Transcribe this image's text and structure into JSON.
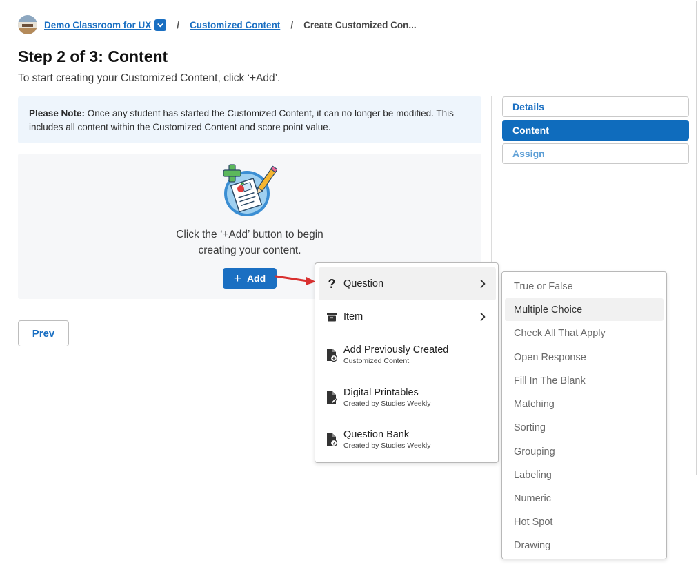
{
  "breadcrumb": {
    "classroom": "Demo Classroom for UX",
    "section": "Customized Content",
    "current": "Create Customized Con..."
  },
  "page": {
    "title": "Step 2 of 3: Content",
    "subtitle": "To start creating your Customized Content, click ‘+Add’."
  },
  "note": {
    "label": "Please Note:",
    "text": " Once any student has started the Customized Content, it can no longer be modified.  This includes all content within the Customized Content and score point value."
  },
  "empty_state": {
    "line1": "Click the ‘+Add’ button to begin",
    "line2": "creating your content.",
    "add_label": "Add"
  },
  "steps": [
    {
      "label": "Details",
      "state": "done"
    },
    {
      "label": "Content",
      "state": "active"
    },
    {
      "label": "Assign",
      "state": "todo"
    }
  ],
  "prev_label": "Prev",
  "add_menu": {
    "items": [
      {
        "label": "Question",
        "icon": "question-mark-icon",
        "has_submenu": true,
        "highlighted": true
      },
      {
        "label": "Item",
        "icon": "box-icon",
        "has_submenu": true
      },
      {
        "label": "Add Previously Created",
        "sublabel": "Customized Content",
        "icon": "file-plus-icon"
      },
      {
        "label": "Digital Printables",
        "sublabel": "Created by Studies Weekly",
        "icon": "file-edit-icon"
      },
      {
        "label": "Question Bank",
        "sublabel": "Created by Studies Weekly",
        "icon": "file-question-icon"
      }
    ]
  },
  "question_submenu": {
    "items": [
      "True or False",
      "Multiple Choice",
      "Check All That Apply",
      "Open Response",
      "Fill In The Blank",
      "Matching",
      "Sorting",
      "Grouping",
      "Labeling",
      "Numeric",
      "Hot Spot",
      "Drawing"
    ],
    "highlighted": "Multiple Choice"
  },
  "colors": {
    "primary": "#1a6fc2",
    "active_step": "#0f6cbd",
    "note_bg": "#eef5fc",
    "annotation_arrow": "#d93030"
  }
}
